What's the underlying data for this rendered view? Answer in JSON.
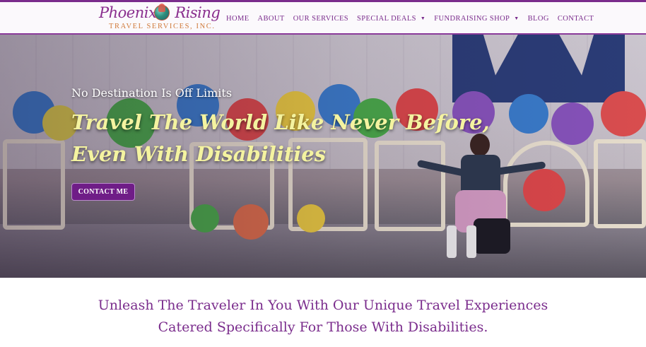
{
  "brand": {
    "name": "Phoenix Rising",
    "name_word1": "Phoenix",
    "name_word2": "Rising",
    "subtitle": "TRAVEL SERVICES, INC.",
    "accent_purple": "#7a2c8c",
    "accent_orange": "#d07a3a"
  },
  "nav": {
    "items": [
      {
        "label": "HOME",
        "has_dropdown": false
      },
      {
        "label": "ABOUT",
        "has_dropdown": false
      },
      {
        "label": "OUR SERVICES",
        "has_dropdown": false
      },
      {
        "label": "SPECIAL DEALS",
        "has_dropdown": true
      },
      {
        "label": "FUNDRAISING SHOP",
        "has_dropdown": true
      },
      {
        "label": "BLOG",
        "has_dropdown": false
      },
      {
        "label": "CONTACT",
        "has_dropdown": false
      }
    ]
  },
  "hero": {
    "tagline": "No Destination Is Off Limits",
    "headline_line1": "Travel The World Like Never Before,",
    "headline_line2": "Even With Disabilities",
    "cta_label": "CONTACT ME",
    "headline_color": "#f4f3a0",
    "cta_color": "#6f1d87"
  },
  "intro": {
    "line1": "Unleash The Traveler In You With Our Unique Travel Experiences",
    "line2": "Catered  Specifically For Those With Disabilities."
  },
  "icons": {
    "logo": "phoenix-globe-logo",
    "dropdown": "chevron-down-icon"
  }
}
